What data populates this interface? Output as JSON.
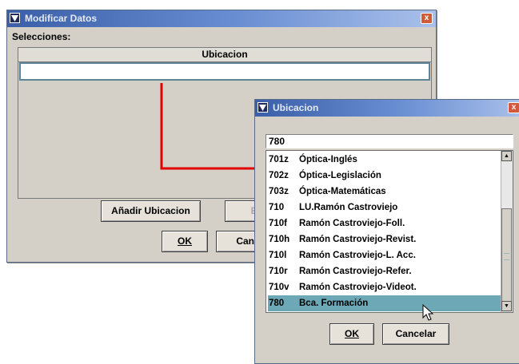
{
  "main_window": {
    "title": "Modificar Datos",
    "close_glyph": "x",
    "selections_label": "Selecciones:",
    "table_header": "Ubicacion",
    "add_button": "Añadir Ubicacion",
    "remove_button": "Eli",
    "ok_button": "OK",
    "cancel_button": "Canc"
  },
  "popup_window": {
    "title": "Ubicacion",
    "close_glyph": "x",
    "search_value": "780",
    "items": [
      {
        "code": "701z",
        "name": "Óptica-Inglés"
      },
      {
        "code": "702z",
        "name": "Óptica-Legislación"
      },
      {
        "code": "703z",
        "name": "Óptica-Matemáticas"
      },
      {
        "code": "710",
        "name": "LU.Ramón Castroviejo"
      },
      {
        "code": "710f",
        "name": "Ramón Castroviejo-Foll."
      },
      {
        "code": "710h",
        "name": "Ramón Castroviejo-Revist."
      },
      {
        "code": "710l",
        "name": "Ramón Castroviejo-L. Acc."
      },
      {
        "code": "710r",
        "name": "Ramón Castroviejo-Refer."
      },
      {
        "code": "710v",
        "name": "Ramón Castroviejo-Videot."
      },
      {
        "code": "780",
        "name": "Bca. Formación"
      }
    ],
    "selected_index": 9,
    "ok_button": "OK",
    "cancel_button": "Cancelar"
  },
  "colors": {
    "title_bar": "#3a5fa8",
    "window_bg": "#d4d0c8",
    "selected_row": "#6ca8b6",
    "annotation_line": "#e00000",
    "close_button": "#d25a3b"
  },
  "icons": {
    "app_icon": "app-logo-icon",
    "close": "close-icon",
    "scroll_up": "arrow-up-icon",
    "scroll_down": "arrow-down-icon",
    "cursor": "mouse-pointer-icon"
  }
}
